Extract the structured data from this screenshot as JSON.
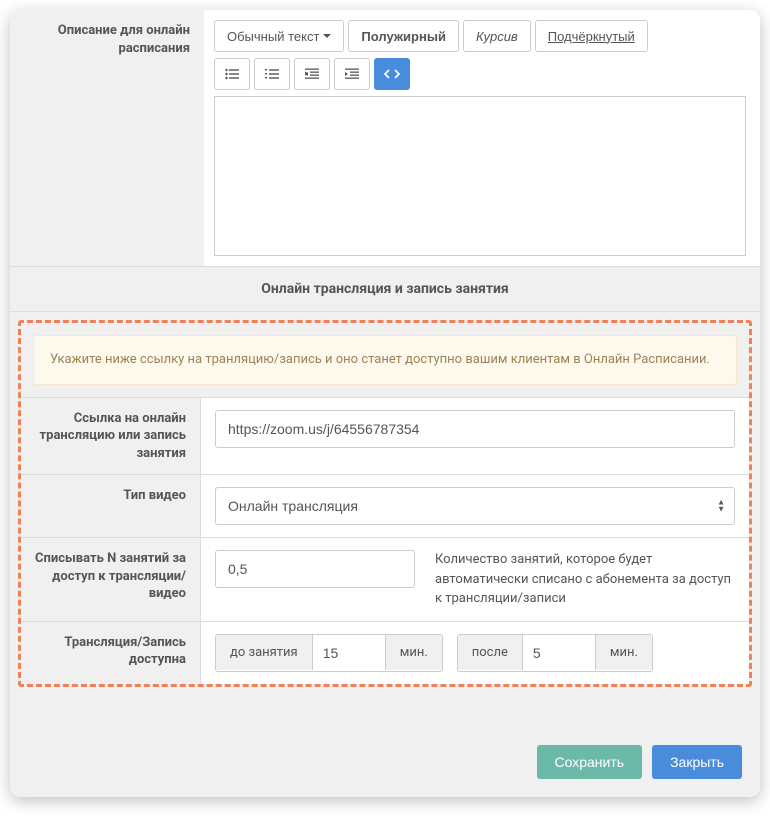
{
  "description": {
    "label": "Описание для онлайн расписания",
    "toolbar": {
      "style_dropdown": "Обычный текст",
      "bold": "Полужирный",
      "italic": "Курсив",
      "underline": "Подчёркнутый"
    }
  },
  "section_header": "Онлайн трансляция и запись занятия",
  "alert_text": "Укажите ниже ссылку на транляцию/запись и оно станет доступно вашим клиентам в Онлайн Расписании.",
  "link": {
    "label": "Ссылка на онлайн трансляцию или запись занятия",
    "value": "https://zoom.us/j/64556787354"
  },
  "video_type": {
    "label": "Тип видео",
    "value": "Онлайн трансляция"
  },
  "nfield": {
    "label": "Списывать N занятий за доступ к трансляции/видео",
    "value": "0,5",
    "help": "Количество занятий, которое будет автоматически списано с абонемента за доступ к трансляции/записи"
  },
  "availability": {
    "label": "Трансляция/Запись доступна",
    "before_label": "до занятия",
    "before_value": "15",
    "after_label": "после",
    "after_value": "5",
    "unit": "мин."
  },
  "buttons": {
    "save": "Сохранить",
    "close": "Закрыть"
  }
}
